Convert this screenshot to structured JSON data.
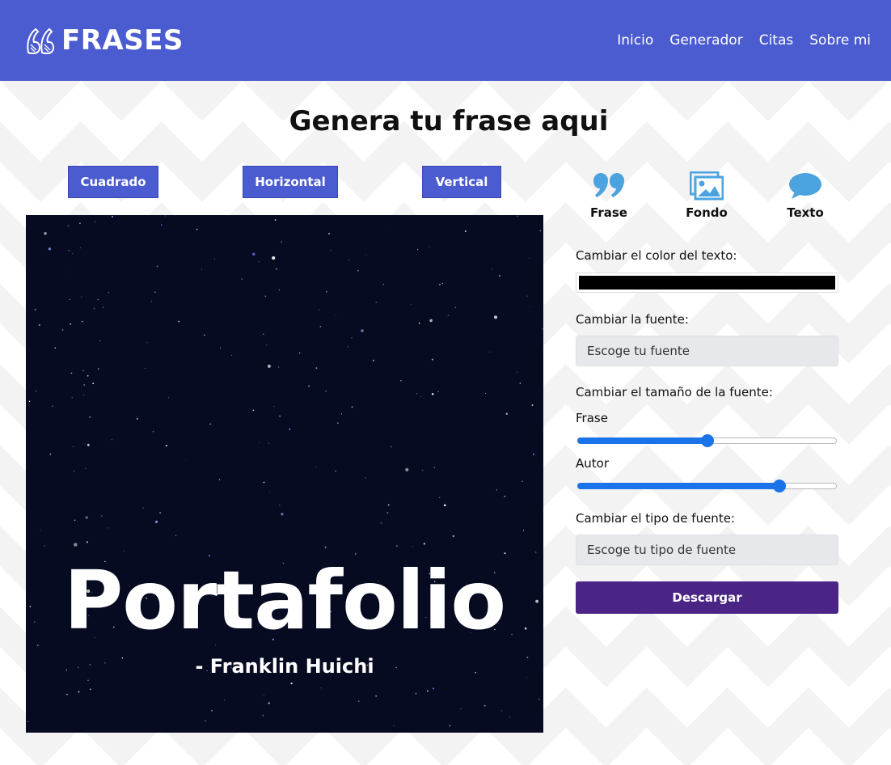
{
  "header": {
    "brand": "FRASES",
    "nav": [
      "Inicio",
      "Generador",
      "Citas",
      "Sobre mi"
    ],
    "background": "#4b5bd0"
  },
  "main": {
    "title": "Genera tu frase aqui",
    "format_buttons": [
      "Cuadrado",
      "Horizontal",
      "Vertical"
    ],
    "preview": {
      "phrase": "Portafolio",
      "author": "- Franklin Huichi",
      "background": "#060b22",
      "text_color": "#ffffff"
    }
  },
  "panel": {
    "tabs": [
      {
        "label": "Frase",
        "icon": "quote-icon"
      },
      {
        "label": "Fondo",
        "icon": "image-icon"
      },
      {
        "label": "Texto",
        "icon": "speech-bubble-icon"
      }
    ],
    "text_color_label": "Cambiar el color del texto:",
    "text_color_value": "#000000",
    "font_label": "Cambiar la fuente:",
    "font_placeholder": "Escoge tu fuente",
    "size_label": "Cambiar el tamaño de la fuente:",
    "phrase_size_label": "Frase",
    "phrase_size_level": 0.5,
    "author_size_label": "Autor",
    "author_size_level": 0.78,
    "font_type_label": "Cambiar el tipo de fuente:",
    "font_type_placeholder": "Escoge tu tipo de fuente",
    "download_label": "Descargar",
    "accent": "#4b5bd0",
    "download_color": "#4a2585",
    "icon_color": "#4ba3e0"
  }
}
